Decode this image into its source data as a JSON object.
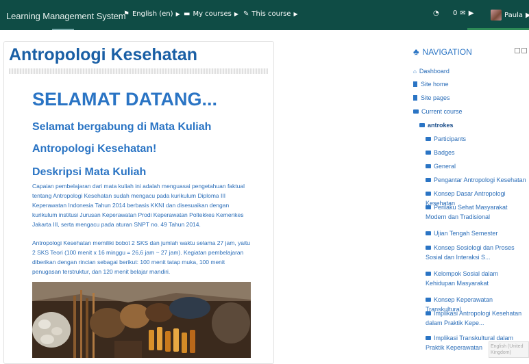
{
  "navbar": {
    "brand": "Learning Management System",
    "language": "English (en)",
    "my_courses": "My courses",
    "this_course": "This course",
    "message_count": "0",
    "user_name": "Paula"
  },
  "main": {
    "course_title": "Antropologi Kesehatan",
    "welcome": "SELAMAT DATANG...",
    "subtitle1": "Selamat bergabung di Mata Kuliah",
    "subtitle2": "Antropologi Kesehatan!",
    "section_heading": "Deskripsi Mata Kuliah",
    "paragraph1": "Capaian pembelajaran dari mata kuliah ini adalah menguasai pengetahuan faktual tentang Antropologi Kesehatan sudah mengacu pada kurikulum Diploma III Keperawatan Indonesia Tahun 2014 berbasis KKNI dan disesuaikan dengan kurikulum institusi Jurusan Keperawatan Prodi Keperawatan Poltekkes Kemenkes Jakarta III, serta mengacu pada aturan SNPT no. 49 Tahun 2014.",
    "paragraph2": "Antropologi Kesehatan memiliki bobot 2 SKS dan jumlah waktu selama 27 jam, yaitu 2 SKS Teori (100 menit x 16 minggu = 26,6 jam ~ 27 jam). Kegiatan pembelajaran diberikan dengan rincian sebagai berikut: 100 menit tatap muka, 100 menit penugasan terstruktur, dan 120 menit belajar mandiri."
  },
  "navigation": {
    "title": "NAVIGATION",
    "dashboard": "Dashboard",
    "site_home": "Site home",
    "site_pages": "Site pages",
    "current_course": "Current course",
    "course_short": "antrokes",
    "items": [
      "Participants",
      "Badges",
      "General",
      "Pengantar Antropologi Kesehatan",
      "Konsep Dasar Antropologi Kesehatan",
      "Perilaku Sehat Masyarakat Modern dan Tradisional",
      "Ujian Tengah Semester",
      "Konsep Sosiologi dan Proses Sosial dan Interaksi S...",
      "Kelompok Sosial dalam Kehidupan Masyarakat",
      "Konsep Keperawatan Transkultural",
      "Implikasi Antropologi Kesehatan dalam Praktik Kepe...",
      "Implikasi Transkultural dalam Praktik Keperawatan"
    ]
  },
  "lang_badge": "English (United Kingdom)",
  "colors": {
    "navbar_bg": "#0f4c45",
    "heading_blue": "#2a74c4",
    "link_blue": "#2a6db8"
  }
}
